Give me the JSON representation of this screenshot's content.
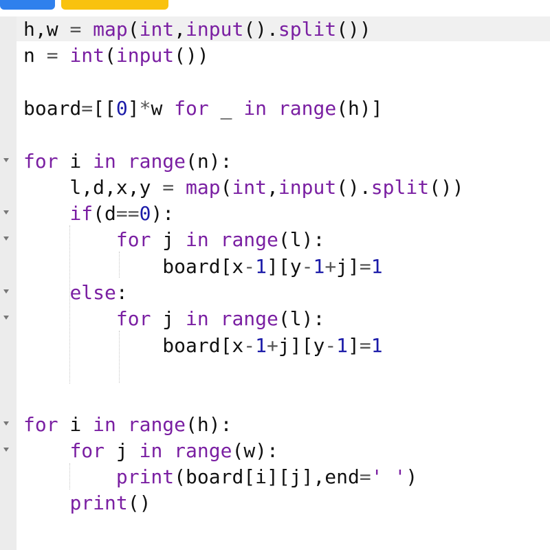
{
  "colors": {
    "tab_blue": "#2f80ed",
    "tab_yellow": "#f9c20e",
    "keyword": "#7a1fa2",
    "number": "#1a1aa8",
    "gutter": "#ececec"
  },
  "icons": [
    "fold-arrow-icon"
  ],
  "code_lines": [
    {
      "fold": false,
      "tokens": [
        [
          "h,w ",
          ""
        ],
        [
          "=",
          "op"
        ],
        [
          " ",
          ""
        ],
        [
          "map",
          "bi"
        ],
        [
          "(",
          ""
        ],
        [
          "int",
          "bi"
        ],
        [
          ",",
          ""
        ],
        [
          "input",
          "bi"
        ],
        [
          "().",
          ""
        ],
        [
          "split",
          "bi"
        ],
        [
          "())",
          ""
        ]
      ]
    },
    {
      "fold": false,
      "tokens": [
        [
          "n ",
          ""
        ],
        [
          "=",
          "op"
        ],
        [
          " ",
          ""
        ],
        [
          "int",
          "bi"
        ],
        [
          "(",
          ""
        ],
        [
          "input",
          "bi"
        ],
        [
          "())",
          ""
        ]
      ]
    },
    {
      "fold": false,
      "tokens": []
    },
    {
      "fold": false,
      "tokens": [
        [
          "board",
          ""
        ],
        [
          "=",
          "op"
        ],
        [
          "[[",
          ""
        ],
        [
          "0",
          "num"
        ],
        [
          "]",
          ""
        ],
        [
          "*",
          "op"
        ],
        [
          "w ",
          ""
        ],
        [
          "for",
          "kw"
        ],
        [
          " _ ",
          ""
        ],
        [
          "in",
          "kw"
        ],
        [
          " ",
          ""
        ],
        [
          "range",
          "bi"
        ],
        [
          "(h)]",
          ""
        ]
      ]
    },
    {
      "fold": false,
      "tokens": []
    },
    {
      "fold": true,
      "tokens": [
        [
          "for",
          "kw"
        ],
        [
          " i ",
          ""
        ],
        [
          "in",
          "kw"
        ],
        [
          " ",
          ""
        ],
        [
          "range",
          "bi"
        ],
        [
          "(n):",
          ""
        ]
      ]
    },
    {
      "fold": false,
      "tokens": [
        [
          "    l,d,x,y ",
          ""
        ],
        [
          "=",
          "op"
        ],
        [
          " ",
          ""
        ],
        [
          "map",
          "bi"
        ],
        [
          "(",
          ""
        ],
        [
          "int",
          "bi"
        ],
        [
          ",",
          ""
        ],
        [
          "input",
          "bi"
        ],
        [
          "().",
          ""
        ],
        [
          "split",
          "bi"
        ],
        [
          "())",
          ""
        ]
      ]
    },
    {
      "fold": true,
      "tokens": [
        [
          "    ",
          ""
        ],
        [
          "if",
          "kw"
        ],
        [
          "(d",
          ""
        ],
        [
          "==",
          "op"
        ],
        [
          "0",
          "num"
        ],
        [
          "):",
          ""
        ]
      ]
    },
    {
      "fold": true,
      "tokens": [
        [
          "        ",
          ""
        ],
        [
          "for",
          "kw"
        ],
        [
          " j ",
          ""
        ],
        [
          "in",
          "kw"
        ],
        [
          " ",
          ""
        ],
        [
          "range",
          "bi"
        ],
        [
          "(l):",
          ""
        ]
      ]
    },
    {
      "fold": false,
      "tokens": [
        [
          "            board[x",
          ""
        ],
        [
          "-",
          "op"
        ],
        [
          "1",
          "num"
        ],
        [
          "][y",
          ""
        ],
        [
          "-",
          "op"
        ],
        [
          "1",
          "num"
        ],
        [
          "+",
          "op"
        ],
        [
          "j]",
          ""
        ],
        [
          "=",
          "op"
        ],
        [
          "1",
          "num"
        ]
      ]
    },
    {
      "fold": true,
      "tokens": [
        [
          "    ",
          ""
        ],
        [
          "else",
          "kw"
        ],
        [
          ":",
          ""
        ]
      ]
    },
    {
      "fold": true,
      "tokens": [
        [
          "        ",
          ""
        ],
        [
          "for",
          "kw"
        ],
        [
          " j ",
          ""
        ],
        [
          "in",
          "kw"
        ],
        [
          " ",
          ""
        ],
        [
          "range",
          "bi"
        ],
        [
          "(l):",
          ""
        ]
      ]
    },
    {
      "fold": false,
      "tokens": [
        [
          "            board[x",
          ""
        ],
        [
          "-",
          "op"
        ],
        [
          "1",
          "num"
        ],
        [
          "+",
          "op"
        ],
        [
          "j][y",
          ""
        ],
        [
          "-",
          "op"
        ],
        [
          "1",
          "num"
        ],
        [
          "]",
          ""
        ],
        [
          "=",
          "op"
        ],
        [
          "1",
          "num"
        ]
      ]
    },
    {
      "fold": false,
      "tokens": []
    },
    {
      "fold": false,
      "tokens": []
    },
    {
      "fold": true,
      "tokens": [
        [
          "for",
          "kw"
        ],
        [
          " i ",
          ""
        ],
        [
          "in",
          "kw"
        ],
        [
          " ",
          ""
        ],
        [
          "range",
          "bi"
        ],
        [
          "(h):",
          ""
        ]
      ]
    },
    {
      "fold": true,
      "tokens": [
        [
          "    ",
          ""
        ],
        [
          "for",
          "kw"
        ],
        [
          " j ",
          ""
        ],
        [
          "in",
          "kw"
        ],
        [
          " ",
          ""
        ],
        [
          "range",
          "bi"
        ],
        [
          "(w):",
          ""
        ]
      ]
    },
    {
      "fold": false,
      "tokens": [
        [
          "        ",
          ""
        ],
        [
          "print",
          "bi"
        ],
        [
          "(board[i][j],end",
          ""
        ],
        [
          "=",
          "op"
        ],
        [
          "' '",
          "str"
        ],
        [
          ")",
          ""
        ]
      ]
    },
    {
      "fold": false,
      "tokens": [
        [
          "    ",
          ""
        ],
        [
          "print",
          "bi"
        ],
        [
          "()",
          ""
        ]
      ]
    }
  ]
}
